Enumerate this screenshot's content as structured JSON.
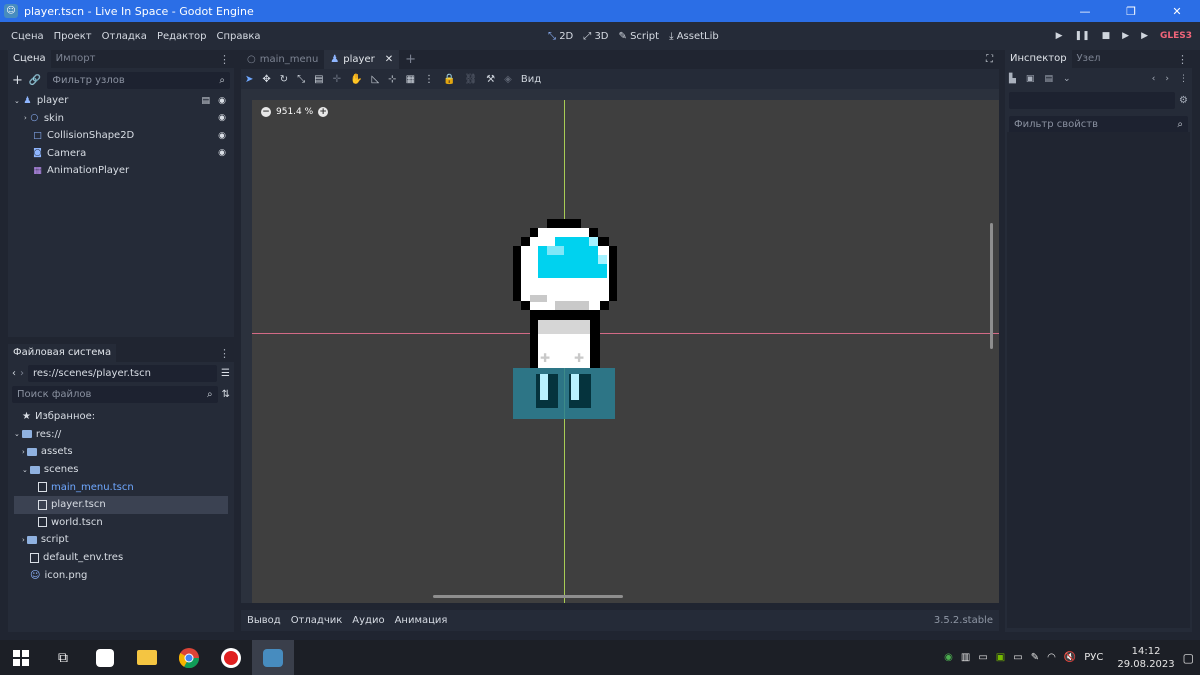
{
  "window": {
    "title": "player.tscn - Live In Space - Godot Engine",
    "controls": [
      "—",
      "❐",
      "✕"
    ]
  },
  "menu": {
    "items": [
      "Сцена",
      "Проект",
      "Отладка",
      "Редактор",
      "Справка"
    ]
  },
  "main_modes": {
    "items": [
      "2D",
      "3D",
      "Script",
      "AssetLib"
    ],
    "active": "2D"
  },
  "renderer": "GLES3",
  "scene_panel": {
    "tabs": [
      "Сцена",
      "Импорт"
    ],
    "filter_placeholder": "Фильтр узлов",
    "nodes": [
      {
        "name": "player",
        "icon": "kinematic-body-icon",
        "color": "#8fb6ff"
      },
      {
        "name": "skin",
        "icon": "sprite-icon",
        "color": "#8fb6ff"
      },
      {
        "name": "CollisionShape2D",
        "icon": "collision-shape-icon",
        "color": "#8fb6ff"
      },
      {
        "name": "Camera",
        "icon": "camera-icon",
        "color": "#8fb6ff"
      },
      {
        "name": "AnimationPlayer",
        "icon": "animation-icon",
        "color": "#c796ff"
      }
    ]
  },
  "filesystem": {
    "title": "Файловая система",
    "path": "res://scenes/player.tscn",
    "search_placeholder": "Поиск файлов",
    "favorites": "Избранное:",
    "root": "res://",
    "items": [
      {
        "name": "assets",
        "type": "folder",
        "level": 2
      },
      {
        "name": "scenes",
        "type": "folder",
        "level": 2
      },
      {
        "name": "main_menu.tscn",
        "type": "scene",
        "level": 3,
        "state": "blue"
      },
      {
        "name": "player.tscn",
        "type": "scene",
        "level": 3,
        "state": "selected"
      },
      {
        "name": "world.tscn",
        "type": "scene",
        "level": 3
      },
      {
        "name": "script",
        "type": "folder",
        "level": 2
      },
      {
        "name": "default_env.tres",
        "type": "file",
        "level": 2
      },
      {
        "name": "icon.png",
        "type": "image",
        "level": 2
      }
    ]
  },
  "editor": {
    "tabs": [
      {
        "label": "main_menu",
        "active": false
      },
      {
        "label": "player",
        "active": true
      }
    ],
    "toolbar_view": "Вид",
    "zoom": "951.4 %"
  },
  "bottom_panel": {
    "tabs": [
      "Вывод",
      "Отладчик",
      "Аудио",
      "Анимация"
    ],
    "version": "3.5.2.stable"
  },
  "inspector": {
    "tabs": [
      "Инспектор",
      "Узел"
    ],
    "filter_placeholder": "Фильтр свойств"
  },
  "taskbar": {
    "language": "РУС",
    "time": "14:12",
    "date": "29.08.2023"
  },
  "colors": {
    "title_bar": "#2b6ee6",
    "accent": "#6fa8ff",
    "viewport_bg": "#3f3f3f"
  }
}
